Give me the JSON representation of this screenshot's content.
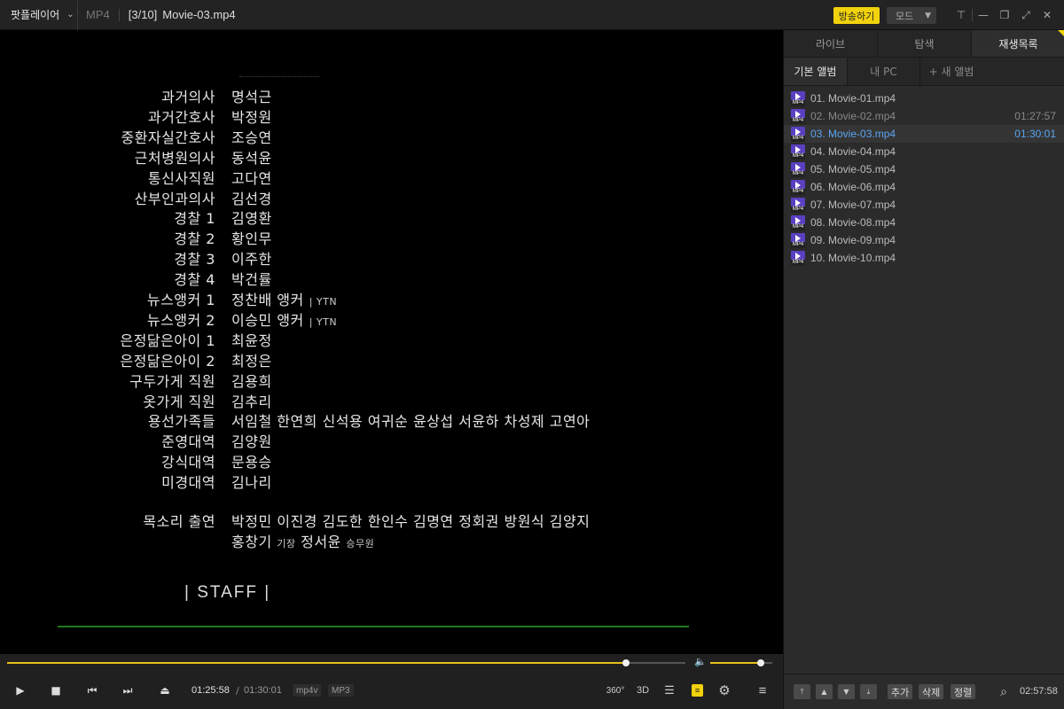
{
  "titlebar": {
    "app_name": "팟플레이어",
    "format": "MP4",
    "index": "[3/10]",
    "filename": "Movie-03.mp4",
    "broadcast_label": "방송하기",
    "mode_label": "모드",
    "window_buttons": [
      "pin-icon",
      "minimize-icon",
      "restore-icon",
      "fullscreen-icon",
      "close-icon"
    ]
  },
  "video": {
    "credits": [
      {
        "role": "과거의사",
        "name": "명석근"
      },
      {
        "role": "과거간호사",
        "name": "박정원"
      },
      {
        "role": "중환자실간호사",
        "name": "조승연"
      },
      {
        "role": "근처병원의사",
        "name": "동석윤"
      },
      {
        "role": "통신사직원",
        "name": "고다연"
      },
      {
        "role": "산부인과의사",
        "name": "김선경"
      },
      {
        "role": "경찰 1",
        "name": "김영환"
      },
      {
        "role": "경찰 2",
        "name": "황인무"
      },
      {
        "role": "경찰 3",
        "name": "이주한"
      },
      {
        "role": "경찰 4",
        "name": "박건률"
      },
      {
        "role": "뉴스앵커 1",
        "name": "정찬배 앵커",
        "note": "| YTN"
      },
      {
        "role": "뉴스앵커 2",
        "name": "이승민 앵커",
        "note": "| YTN"
      },
      {
        "role": "은정닮은아이 1",
        "name": "최윤정"
      },
      {
        "role": "은정닮은아이 2",
        "name": "최정은"
      },
      {
        "role": "구두가게 직원",
        "name": "김용희"
      },
      {
        "role": "옷가게 직원",
        "name": "김추리"
      },
      {
        "role": "용선가족들",
        "name": "서임철 한연희 신석용 여귀순 윤상섭 서윤하 차성제 고연아"
      },
      {
        "role": "준영대역",
        "name": "김양원"
      },
      {
        "role": "강식대역",
        "name": "문용승"
      },
      {
        "role": "미경대역",
        "name": "김나리"
      }
    ],
    "voice_role": "목소리 출연",
    "voice_line1": "박정민 이진경 김도한 한인수 김명연 정회권 방원식 김양지",
    "voice_line2_a": "홍창기",
    "voice_line2_b": "기장",
    "voice_line2_c": "정서윤",
    "voice_line2_d": "승무원",
    "staff_label": "| STAFF |"
  },
  "progress": {
    "position_fraction": 0.913,
    "volume_fraction": 0.82
  },
  "controls": {
    "current_time": "01:25:58",
    "slash": "/",
    "total_time": "01:30:01",
    "video_codec": "mp4v",
    "audio_codec": "MP3",
    "btn_360": "360°",
    "btn_3d": "3D"
  },
  "panel": {
    "tabs": [
      "라이브",
      "탐색",
      "재생목록"
    ],
    "active_tab": 2,
    "subtabs": [
      "기본 앨범",
      "내 PC",
      "+ 새 앨범"
    ],
    "playlist": [
      {
        "name": "01. Movie-01.mp4",
        "duration": ""
      },
      {
        "name": "02. Movie-02.mp4",
        "duration": "01:27:57"
      },
      {
        "name": "03. Movie-03.mp4",
        "duration": "01:30:01"
      },
      {
        "name": "04. Movie-04.mp4",
        "duration": ""
      },
      {
        "name": "05. Movie-05.mp4",
        "duration": ""
      },
      {
        "name": "06. Movie-06.mp4",
        "duration": ""
      },
      {
        "name": "07. Movie-07.mp4",
        "duration": ""
      },
      {
        "name": "08. Movie-08.mp4",
        "duration": ""
      },
      {
        "name": "09. Movie-09.mp4",
        "duration": ""
      },
      {
        "name": "10. Movie-10.mp4",
        "duration": ""
      }
    ],
    "file_badge": "MP4",
    "add_label": "추가",
    "delete_label": "삭제",
    "sort_label": "정렬",
    "total_duration": "02:57:58"
  },
  "colors": {
    "accent": "#f2d20c",
    "current_item": "#5aa4f0",
    "credit_line": "#1e7a1e"
  }
}
